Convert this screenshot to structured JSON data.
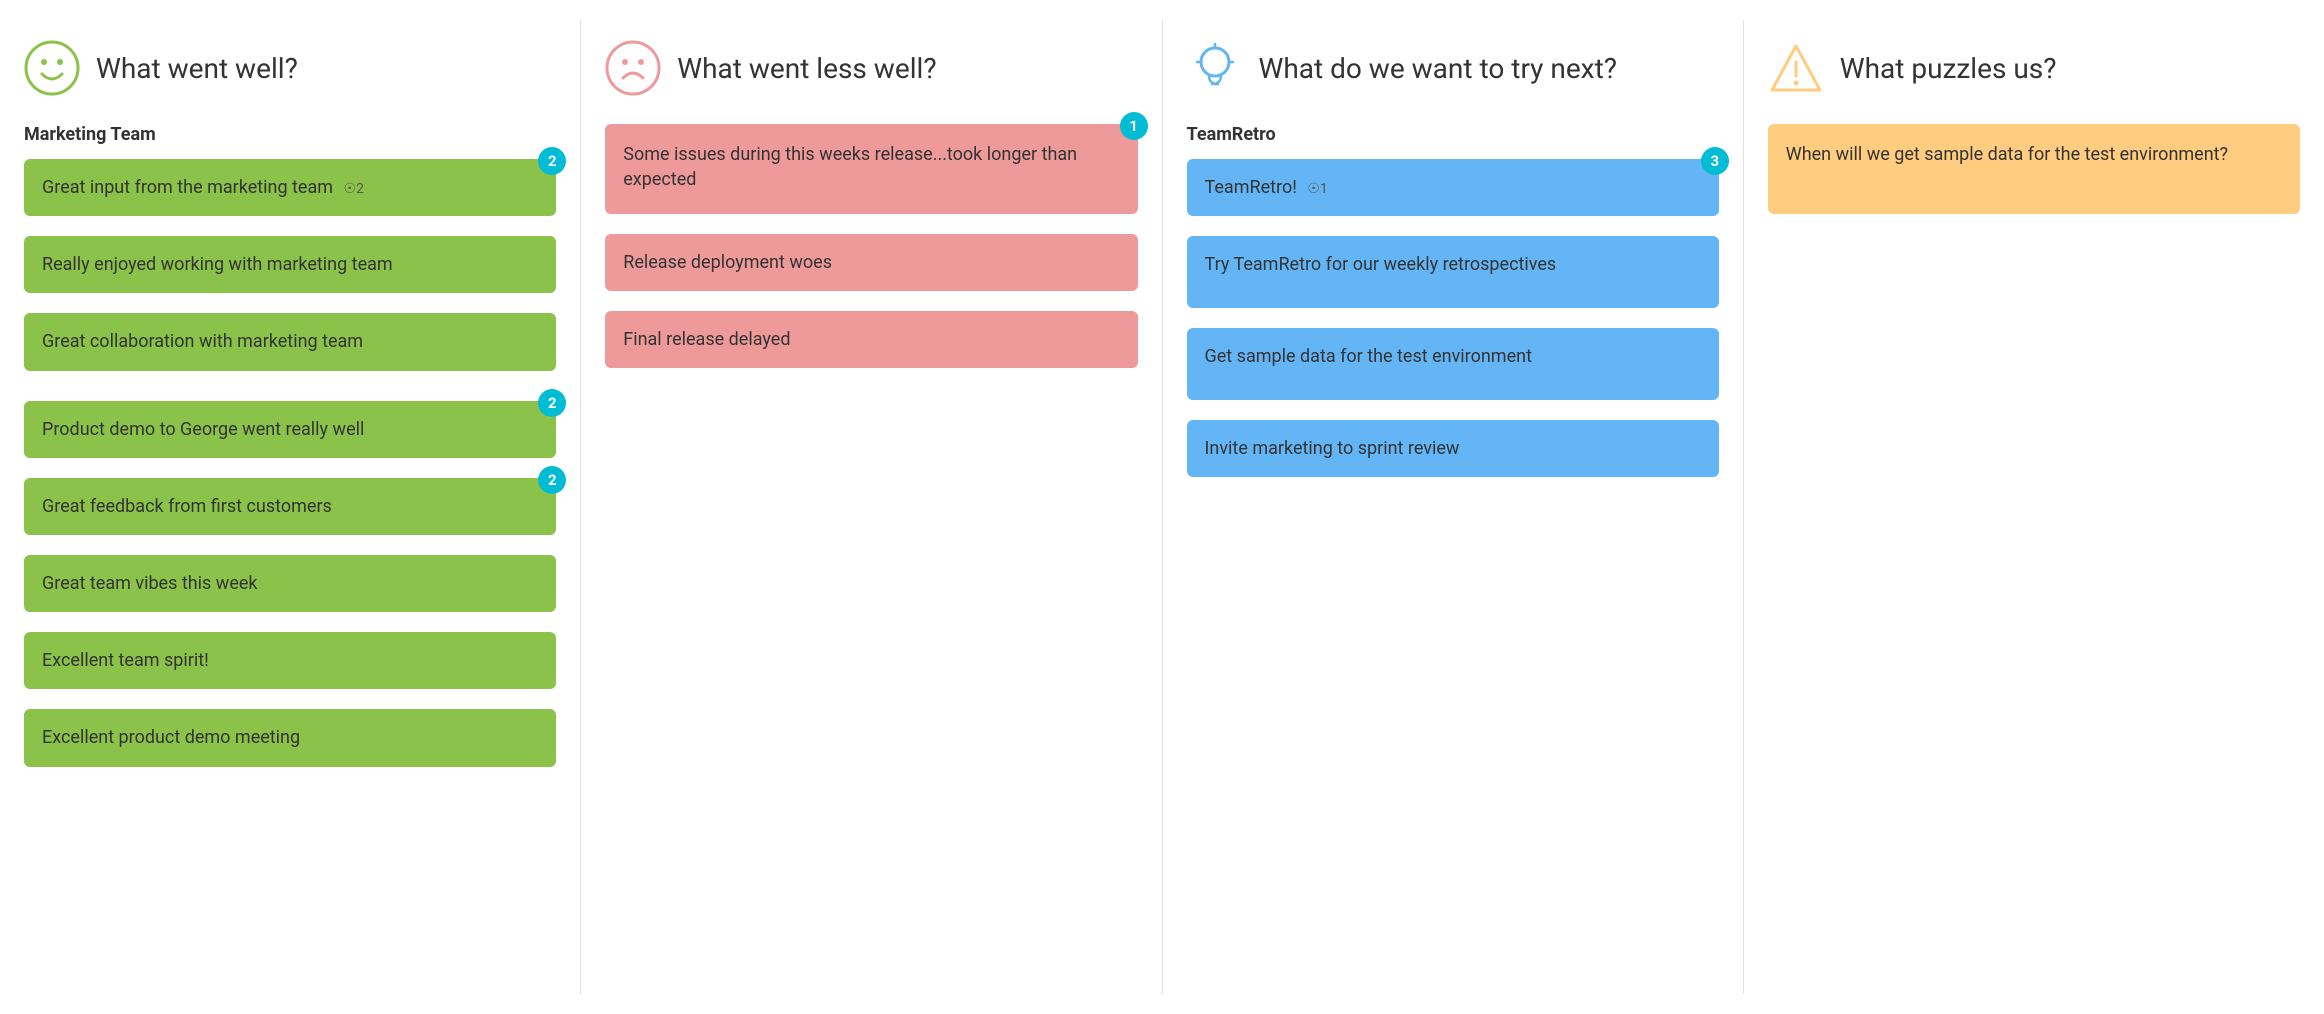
{
  "columns": [
    {
      "id": "went-well",
      "icon": "smiley",
      "title": "What went well?",
      "sections": [
        {
          "label": "Marketing Team",
          "groups": [
            {
              "badge": 2,
              "cards": [
                {
                  "text": "Great input from the marketing team",
                  "vote": 2
                }
              ]
            },
            {
              "badge": null,
              "cards": [
                {
                  "text": "Really enjoyed working with marketing team",
                  "vote": null
                }
              ]
            },
            {
              "badge": null,
              "cards": [
                {
                  "text": "Great collaboration with marketing team",
                  "vote": null
                }
              ]
            }
          ]
        },
        {
          "label": null,
          "groups": [
            {
              "badge": 2,
              "cards": [
                {
                  "text": "Product demo to George went really well",
                  "vote": null
                }
              ]
            },
            {
              "badge": 2,
              "cards": [
                {
                  "text": "Great feedback from first customers",
                  "vote": null
                }
              ]
            },
            {
              "badge": null,
              "cards": [
                {
                  "text": "Great team vibes this week",
                  "vote": null
                }
              ]
            },
            {
              "badge": null,
              "cards": [
                {
                  "text": "Excellent team spirit!",
                  "vote": null
                }
              ]
            },
            {
              "badge": null,
              "cards": [
                {
                  "text": "Excellent product demo meeting",
                  "vote": null
                }
              ]
            }
          ]
        }
      ],
      "color": "green"
    },
    {
      "id": "less-well",
      "icon": "frowny",
      "title": "What went less well?",
      "sections": [
        {
          "label": null,
          "groups": [
            {
              "badge": 1,
              "cards": [
                {
                  "text": "Some issues during this weeks release...took longer than expected",
                  "vote": null
                }
              ]
            },
            {
              "badge": null,
              "cards": [
                {
                  "text": "Release deployment woes",
                  "vote": null
                }
              ]
            },
            {
              "badge": null,
              "cards": [
                {
                  "text": "Final release delayed",
                  "vote": null
                }
              ]
            }
          ]
        }
      ],
      "color": "red"
    },
    {
      "id": "try-next",
      "icon": "lightbulb",
      "title": "What do we want to try next?",
      "sections": [
        {
          "label": "TeamRetro",
          "groups": [
            {
              "badge": 3,
              "cards": [
                {
                  "text": "TeamRetro!",
                  "vote": 1
                }
              ]
            },
            {
              "badge": null,
              "cards": [
                {
                  "text": "Try TeamRetro for our weekly retrospectives",
                  "vote": null
                }
              ]
            },
            {
              "badge": null,
              "cards": [
                {
                  "text": "Get sample data for the test environment",
                  "vote": null
                }
              ]
            },
            {
              "badge": null,
              "cards": [
                {
                  "text": "Invite marketing to sprint review",
                  "vote": null
                }
              ]
            }
          ]
        }
      ],
      "color": "blue"
    },
    {
      "id": "puzzles",
      "icon": "warning",
      "title": "What puzzles us?",
      "sections": [
        {
          "label": null,
          "groups": [
            {
              "badge": null,
              "cards": [
                {
                  "text": "When will we get sample data for the test environment?",
                  "vote": null
                }
              ]
            }
          ]
        }
      ],
      "color": "orange"
    }
  ]
}
